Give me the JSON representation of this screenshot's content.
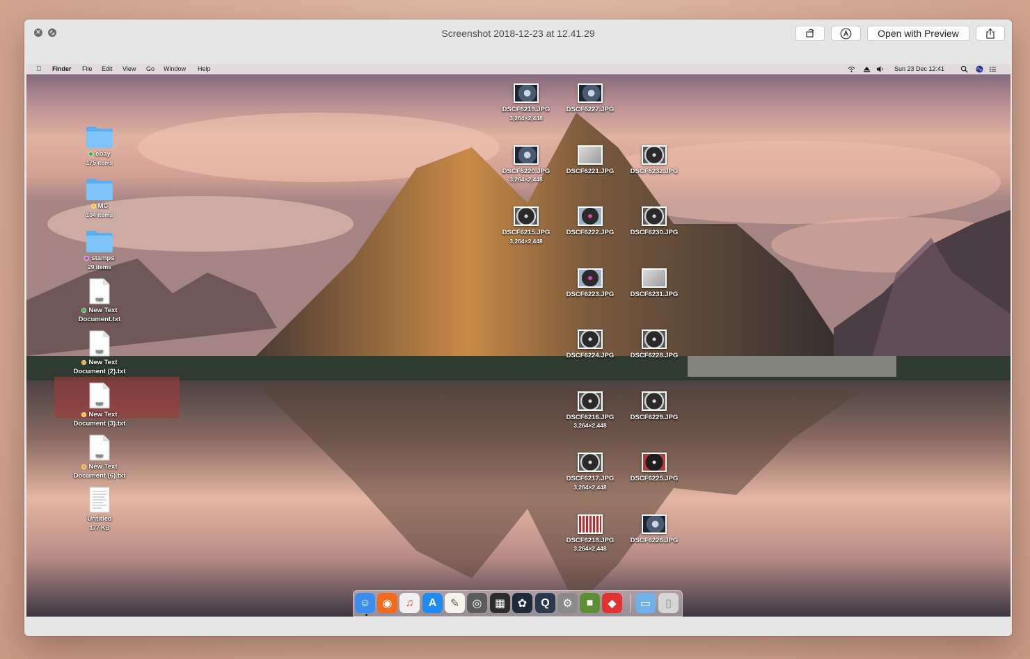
{
  "window": {
    "title": "Screenshot 2018-12-23 at 12.41.29",
    "open_with_label": "Open with Preview"
  },
  "menubar": {
    "app_name": "Finder",
    "items": [
      "File",
      "Edit",
      "View",
      "Go",
      "Window",
      "Help"
    ],
    "clock": "Sun 23 Dec  12:41"
  },
  "left_items": [
    {
      "name": "ebay",
      "meta": "175 items",
      "kind": "folder",
      "tag": "#38b44a"
    },
    {
      "name": "MC",
      "meta": "104 items",
      "kind": "folder",
      "tag": "#f2c12e"
    },
    {
      "name": "stamps",
      "meta": "29 items",
      "kind": "folder",
      "tag": "#a451d6"
    },
    {
      "name": "New Text Document.txt",
      "line1": "New Text",
      "line2": "Document.txt",
      "kind": "txt",
      "tag": "#38b44a"
    },
    {
      "name": "New Text Document (2).txt",
      "line1": "New Text",
      "line2": "Document (2).txt",
      "kind": "txt",
      "tag": "#f5a623"
    },
    {
      "name": "New Text Document (3).txt",
      "line1": "New Text",
      "line2": "Document (3).txt",
      "kind": "txt",
      "tag": "#f2c12e"
    },
    {
      "name": "New Text Document (6).txt",
      "line1": "New Text",
      "line2": "Document (6).txt",
      "kind": "txt",
      "tag": "#f5a623"
    },
    {
      "name": "Untitled",
      "meta": "177 KB",
      "kind": "doc",
      "tag": ""
    }
  ],
  "file_label": "TXT",
  "photos": [
    {
      "name": "DSCF6219.JPG",
      "meta": "3,264×2,448",
      "style": "a"
    },
    {
      "name": "DSCF6227.JPG",
      "meta": "",
      "style": "a"
    },
    {
      "name": "DSCF6220.JPG",
      "meta": "3,264×2,448",
      "style": "a"
    },
    {
      "name": "DSCF6221.JPG",
      "meta": "",
      "style": "c"
    },
    {
      "name": "DSCF6232.JPG",
      "meta": "",
      "style": "r"
    },
    {
      "name": "DSCF6215.JPG",
      "meta": "3,264×2,448",
      "style": "r"
    },
    {
      "name": "DSCF6222.JPG",
      "meta": "",
      "style": "p"
    },
    {
      "name": "DSCF6230.JPG",
      "meta": "",
      "style": "r"
    },
    {
      "name": "DSCF6223.JPG",
      "meta": "",
      "style": "p"
    },
    {
      "name": "DSCF6231.JPG",
      "meta": "",
      "style": "c"
    },
    {
      "name": "DSCF6224.JPG",
      "meta": "",
      "style": "r"
    },
    {
      "name": "DSCF6228.JPG",
      "meta": "",
      "style": "r"
    },
    {
      "name": "DSCF6216.JPG",
      "meta": "3,264×2,448",
      "style": "r"
    },
    {
      "name": "DSCF6229.JPG",
      "meta": "",
      "style": "r"
    },
    {
      "name": "DSCF6217.JPG",
      "meta": "3,264×2,448",
      "style": "r"
    },
    {
      "name": "DSCF6225.JPG",
      "meta": "",
      "style": "x"
    },
    {
      "name": "DSCF6218.JPG",
      "meta": "3,264×2,448",
      "style": "s"
    },
    {
      "name": "DSCF6226.JPG",
      "meta": "",
      "style": "a"
    }
  ],
  "dock": [
    {
      "name": "Finder",
      "icon": "finder-icon",
      "color": "#3a8ef0"
    },
    {
      "name": "Firefox",
      "icon": "firefox-icon",
      "color": "#f26b1d"
    },
    {
      "name": "iTunes",
      "icon": "itunes-icon",
      "color": "#f0f0f0"
    },
    {
      "name": "App Store",
      "icon": "app-store-icon",
      "color": "#1f8bf2"
    },
    {
      "name": "TextEdit",
      "icon": "textedit-icon",
      "color": "#f5f3ea"
    },
    {
      "name": "Photo Booth",
      "icon": "camera-icon",
      "color": "#5c5c5c"
    },
    {
      "name": "Final Cut Pro",
      "icon": "clapper-icon",
      "color": "#2c2c2c"
    },
    {
      "name": "DaVinci Resolve",
      "icon": "resolve-icon",
      "color": "#1e2a3a"
    },
    {
      "name": "QuickTime Player",
      "icon": "quicktime-icon",
      "color": "#2a3a4c"
    },
    {
      "name": "System Preferences",
      "icon": "gear-icon",
      "color": "#8a8a8a"
    },
    {
      "name": "Minecraft",
      "icon": "minecraft-icon",
      "color": "#5d8f32"
    },
    {
      "name": "Roblox",
      "icon": "roblox-icon",
      "color": "#e23232"
    },
    {
      "name": "Downloads",
      "icon": "folder-icon",
      "color": "#6fb2ea"
    },
    {
      "name": "Trash",
      "icon": "trash-icon",
      "color": "#d6d6d6"
    }
  ]
}
